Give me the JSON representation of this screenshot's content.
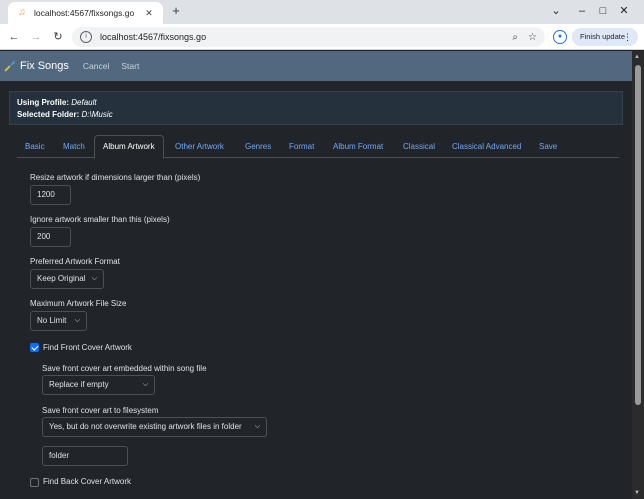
{
  "browser": {
    "tab_title": "localhost:4567/fixsongs.go",
    "url": "localhost:4567/fixsongs.go",
    "update_button": "Finish update"
  },
  "app": {
    "brand": "Fix Songs",
    "nav": [
      "Cancel",
      "Start"
    ]
  },
  "info": {
    "profile_label": "Using Profile:",
    "profile_value": "Default",
    "folder_label": "Selected Folder:",
    "folder_value": "D:\\Music"
  },
  "tabs": [
    "Basic",
    "Match",
    "Album Artwork",
    "Other Artwork",
    "Genres",
    "Format",
    "Album Format",
    "Classical",
    "Classical Advanced",
    "Save"
  ],
  "active_tab": "Album Artwork",
  "form": {
    "resize_label": "Resize artwork if dimensions larger than (pixels)",
    "resize_value": "1200",
    "ignore_label": "Ignore artwork smaller than this (pixels)",
    "ignore_value": "200",
    "format_label": "Preferred Artwork Format",
    "format_value": "Keep Original",
    "maxsize_label": "Maximum Artwork File Size",
    "maxsize_value": "No Limit",
    "find_front_label": "Find Front Cover Artwork",
    "find_front_checked": true,
    "embed_label": "Save front cover art embedded within song file",
    "embed_value": "Replace if empty",
    "fs_label": "Save front cover art to filesystem",
    "fs_value": "Yes, but do not overwrite existing artwork files in folder",
    "fs_filename": "folder",
    "find_back_label": "Find Back Cover Artwork",
    "find_back_checked": false
  }
}
